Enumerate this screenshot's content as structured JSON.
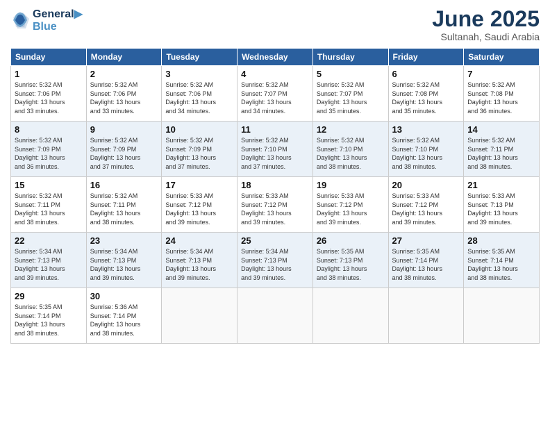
{
  "logo": {
    "line1": "General",
    "line2": "Blue"
  },
  "title": "June 2025",
  "subtitle": "Sultanah, Saudi Arabia",
  "days_of_week": [
    "Sunday",
    "Monday",
    "Tuesday",
    "Wednesday",
    "Thursday",
    "Friday",
    "Saturday"
  ],
  "weeks": [
    [
      {
        "day": "1",
        "text": "Sunrise: 5:32 AM\nSunset: 7:06 PM\nDaylight: 13 hours\nand 33 minutes."
      },
      {
        "day": "2",
        "text": "Sunrise: 5:32 AM\nSunset: 7:06 PM\nDaylight: 13 hours\nand 33 minutes."
      },
      {
        "day": "3",
        "text": "Sunrise: 5:32 AM\nSunset: 7:06 PM\nDaylight: 13 hours\nand 34 minutes."
      },
      {
        "day": "4",
        "text": "Sunrise: 5:32 AM\nSunset: 7:07 PM\nDaylight: 13 hours\nand 34 minutes."
      },
      {
        "day": "5",
        "text": "Sunrise: 5:32 AM\nSunset: 7:07 PM\nDaylight: 13 hours\nand 35 minutes."
      },
      {
        "day": "6",
        "text": "Sunrise: 5:32 AM\nSunset: 7:08 PM\nDaylight: 13 hours\nand 35 minutes."
      },
      {
        "day": "7",
        "text": "Sunrise: 5:32 AM\nSunset: 7:08 PM\nDaylight: 13 hours\nand 36 minutes."
      }
    ],
    [
      {
        "day": "8",
        "text": "Sunrise: 5:32 AM\nSunset: 7:09 PM\nDaylight: 13 hours\nand 36 minutes."
      },
      {
        "day": "9",
        "text": "Sunrise: 5:32 AM\nSunset: 7:09 PM\nDaylight: 13 hours\nand 37 minutes."
      },
      {
        "day": "10",
        "text": "Sunrise: 5:32 AM\nSunset: 7:09 PM\nDaylight: 13 hours\nand 37 minutes."
      },
      {
        "day": "11",
        "text": "Sunrise: 5:32 AM\nSunset: 7:10 PM\nDaylight: 13 hours\nand 37 minutes."
      },
      {
        "day": "12",
        "text": "Sunrise: 5:32 AM\nSunset: 7:10 PM\nDaylight: 13 hours\nand 38 minutes."
      },
      {
        "day": "13",
        "text": "Sunrise: 5:32 AM\nSunset: 7:10 PM\nDaylight: 13 hours\nand 38 minutes."
      },
      {
        "day": "14",
        "text": "Sunrise: 5:32 AM\nSunset: 7:11 PM\nDaylight: 13 hours\nand 38 minutes."
      }
    ],
    [
      {
        "day": "15",
        "text": "Sunrise: 5:32 AM\nSunset: 7:11 PM\nDaylight: 13 hours\nand 38 minutes."
      },
      {
        "day": "16",
        "text": "Sunrise: 5:32 AM\nSunset: 7:11 PM\nDaylight: 13 hours\nand 38 minutes."
      },
      {
        "day": "17",
        "text": "Sunrise: 5:33 AM\nSunset: 7:12 PM\nDaylight: 13 hours\nand 39 minutes."
      },
      {
        "day": "18",
        "text": "Sunrise: 5:33 AM\nSunset: 7:12 PM\nDaylight: 13 hours\nand 39 minutes."
      },
      {
        "day": "19",
        "text": "Sunrise: 5:33 AM\nSunset: 7:12 PM\nDaylight: 13 hours\nand 39 minutes."
      },
      {
        "day": "20",
        "text": "Sunrise: 5:33 AM\nSunset: 7:12 PM\nDaylight: 13 hours\nand 39 minutes."
      },
      {
        "day": "21",
        "text": "Sunrise: 5:33 AM\nSunset: 7:13 PM\nDaylight: 13 hours\nand 39 minutes."
      }
    ],
    [
      {
        "day": "22",
        "text": "Sunrise: 5:34 AM\nSunset: 7:13 PM\nDaylight: 13 hours\nand 39 minutes."
      },
      {
        "day": "23",
        "text": "Sunrise: 5:34 AM\nSunset: 7:13 PM\nDaylight: 13 hours\nand 39 minutes."
      },
      {
        "day": "24",
        "text": "Sunrise: 5:34 AM\nSunset: 7:13 PM\nDaylight: 13 hours\nand 39 minutes."
      },
      {
        "day": "25",
        "text": "Sunrise: 5:34 AM\nSunset: 7:13 PM\nDaylight: 13 hours\nand 39 minutes."
      },
      {
        "day": "26",
        "text": "Sunrise: 5:35 AM\nSunset: 7:13 PM\nDaylight: 13 hours\nand 38 minutes."
      },
      {
        "day": "27",
        "text": "Sunrise: 5:35 AM\nSunset: 7:14 PM\nDaylight: 13 hours\nand 38 minutes."
      },
      {
        "day": "28",
        "text": "Sunrise: 5:35 AM\nSunset: 7:14 PM\nDaylight: 13 hours\nand 38 minutes."
      }
    ],
    [
      {
        "day": "29",
        "text": "Sunrise: 5:35 AM\nSunset: 7:14 PM\nDaylight: 13 hours\nand 38 minutes."
      },
      {
        "day": "30",
        "text": "Sunrise: 5:36 AM\nSunset: 7:14 PM\nDaylight: 13 hours\nand 38 minutes."
      },
      {
        "day": "",
        "text": ""
      },
      {
        "day": "",
        "text": ""
      },
      {
        "day": "",
        "text": ""
      },
      {
        "day": "",
        "text": ""
      },
      {
        "day": "",
        "text": ""
      }
    ]
  ]
}
